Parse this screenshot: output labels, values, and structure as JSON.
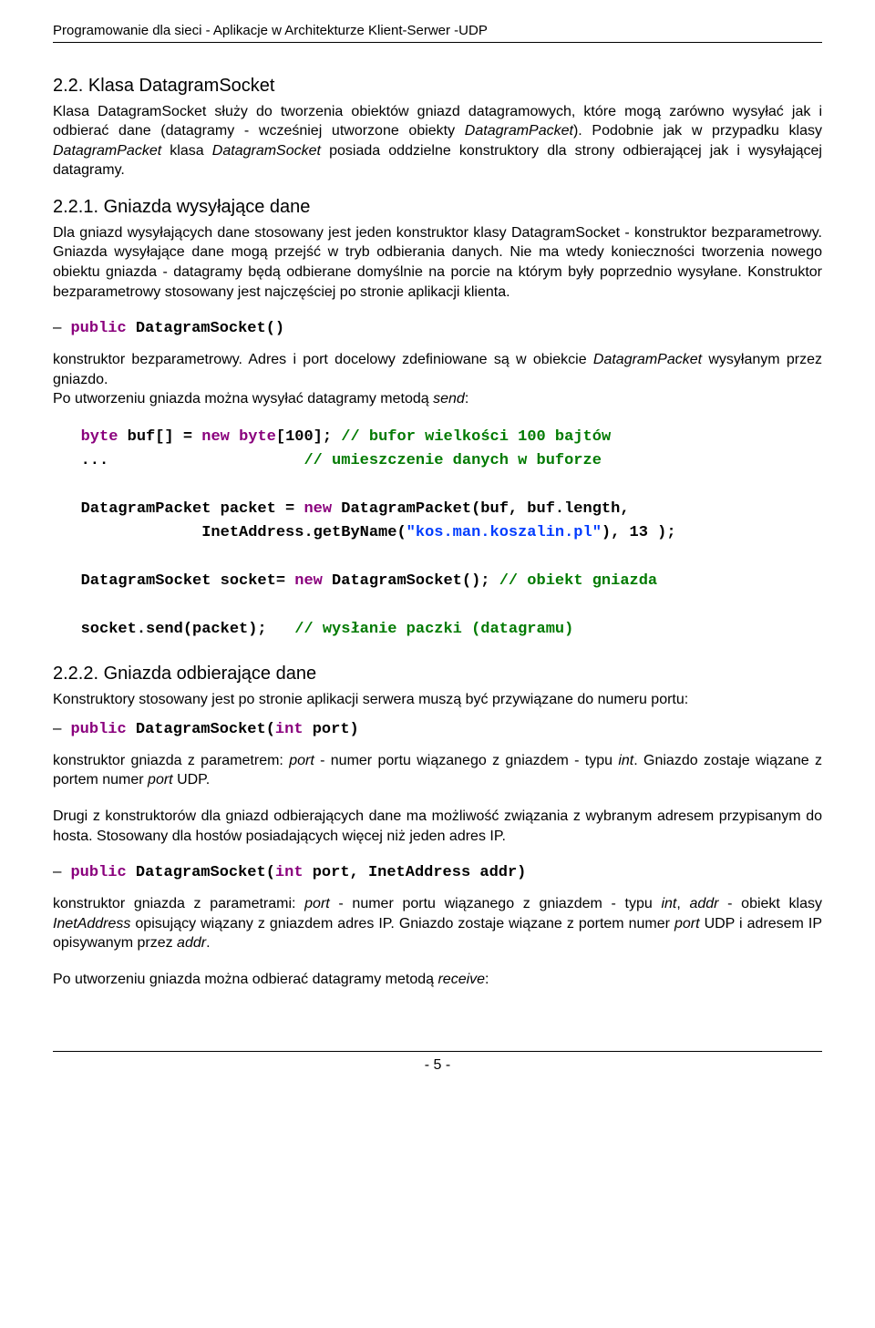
{
  "header": {
    "running_title": "Programowanie dla sieci - Aplikacje w Architekturze Klient-Serwer -UDP"
  },
  "sec22": {
    "title": "2.2. Klasa DatagramSocket",
    "p1_html": "Klasa DatagramSocket służy do tworzenia obiektów gniazd datagramowych, które mogą zarówno wysyłać jak i odbierać dane (datagramy - wcześniej utworzone obiekty <i>DatagramPacket</i>). Podobnie jak w przypadku klasy <i>DatagramPacket</i> klasa <i>DatagramSocket</i> posiada oddzielne konstruktory dla strony odbierającej jak i wysyłającej datagramy."
  },
  "sec221": {
    "title": "2.2.1. Gniazda wysyłające dane",
    "p1": "Dla gniazd wysyłających dane stosowany jest jeden konstruktor klasy DatagramSocket - konstruktor bezparametrowy. Gniazda wysyłające dane mogą przejść w tryb odbierania danych. Nie ma wtedy konieczności tworzenia nowego obiektu gniazda - datagramy będą odbierane domyślnie na porcie na którym były poprzednio wysyłane. Konstruktor bezparametrowy stosowany jest najczęściej po stronie aplikacji klienta.",
    "sig1_html": "<span class=\"dash\">&ndash;</span><span class=\"kw\">public</span> DatagramSocket()",
    "p2_html": "konstruktor bezparametrowy. Adres i port docelowy zdefiniowane są w obiekcie <i>DatagramPacket</i> wysyłanym przez gniazdo.<br>Po utworzeniu gniazda można wysyłać datagramy metodą <i>send</i>:",
    "code_html": "   <span class=\"kw\">byte</span> buf[] = <span class=\"kw\">new</span> <span class=\"kw\">byte</span>[100]; <span class=\"cm\">// bufor wielkości 100 bajtów</span>\n   ...                     <span class=\"cm\">// umieszczenie danych w buforze</span>\n\n   DatagramPacket packet = <span class=\"kw\">new</span> DatagramPacket(buf, buf.length,\n                InetAddress.getByName(<span class=\"str\">\"kos.man.koszalin.pl\"</span>), 13 );\n\n   DatagramSocket socket= <span class=\"kw\">new</span> DatagramSocket(); <span class=\"cm\">// obiekt gniazda</span>\n\n   socket.send(packet);   <span class=\"cm\">// wysłanie paczki (datagramu)</span>"
  },
  "sec222": {
    "title": "2.2.2. Gniazda odbierające dane",
    "p1": "Konstruktory stosowany jest po stronie aplikacji serwera muszą być przywiązane do numeru portu:",
    "sig1_html": "<span class=\"dash\">&ndash;</span><span class=\"kw\">public</span> DatagramSocket(<span class=\"kw\">int</span> port)",
    "p2_html": "konstruktor gniazda z parametrem: <i>port</i> - numer portu wiązanego z gniazdem - typu <i>int</i>. Gniazdo zostaje wiązane z portem numer <i>port</i> UDP.",
    "p3": "Drugi z konstruktorów dla gniazd odbierających dane ma możliwość związania z wybranym adresem przypisanym do hosta. Stosowany dla hostów posiadających więcej niż jeden adres IP.",
    "sig2_html": "<span class=\"dash\">&ndash;</span><span class=\"kw\">public</span> DatagramSocket(<span class=\"kw\">int</span> port, InetAddress addr)",
    "p4_html": "konstruktor gniazda z parametrami: <i>port</i> - numer portu wiązanego z gniazdem - typu <i>int</i>, <i>addr</i> - obiekt klasy <i>InetAddress</i> opisujący wiązany z gniazdem adres IP. Gniazdo zostaje wiązane z portem numer <i>port</i> UDP i adresem IP opisywanym przez <i>addr</i>.",
    "p5_html": "Po utworzeniu gniazda można odbierać datagramy metodą <i>receive</i>:"
  },
  "footer": {
    "page_number": "- 5 -"
  }
}
